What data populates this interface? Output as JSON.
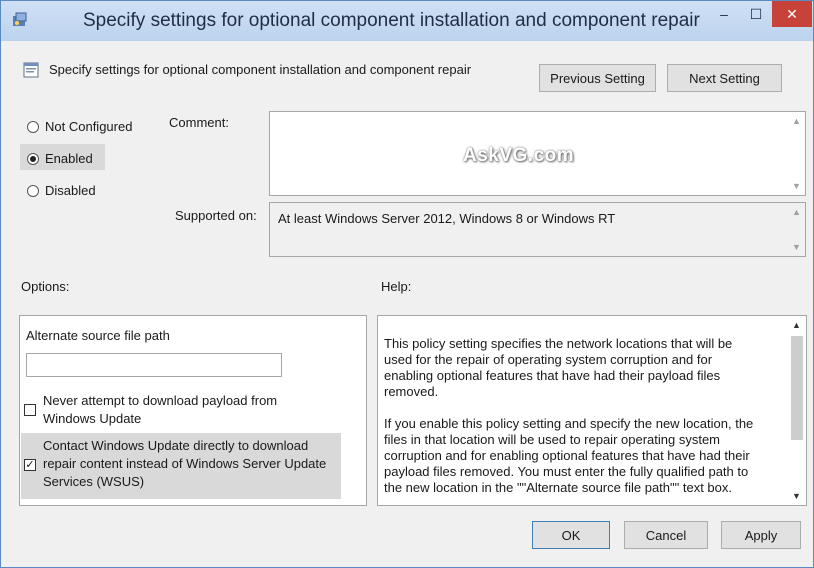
{
  "window": {
    "title": "Specify settings for optional component installation and component repair",
    "controls": {
      "minimize": "–",
      "maximize": "☐",
      "close": "✕"
    }
  },
  "header": {
    "setting_name": "Specify settings for optional component installation and component repair",
    "previous_label": "Previous Setting",
    "next_label": "Next Setting"
  },
  "state": {
    "options": [
      {
        "label": "Not Configured",
        "selected": false
      },
      {
        "label": "Enabled",
        "selected": true
      },
      {
        "label": "Disabled",
        "selected": false
      }
    ]
  },
  "comment": {
    "label": "Comment:",
    "value": ""
  },
  "watermark": "AskVG.com",
  "supported": {
    "label": "Supported on:",
    "value": "At least Windows Server 2012, Windows 8 or Windows RT"
  },
  "options_section": {
    "label": "Options:",
    "alt_path_label": "Alternate source file path",
    "alt_path_value": "",
    "never_download": {
      "label": "Never attempt to download payload from Windows Update",
      "checked": false
    },
    "contact_wu": {
      "label": "Contact Windows Update directly to download repair content instead of Windows Server Update Services (WSUS)",
      "checked": true
    }
  },
  "help": {
    "label": "Help:",
    "paragraphs": [
      "This policy setting specifies the network locations that will be used for the repair of operating system corruption and for enabling optional features that have had their payload files removed.",
      "If you enable this policy setting and specify the new location, the files in that location will be used to repair operating system corruption and for enabling optional features that have had their payload files removed. You must enter the fully qualified path to the new location in the \"\"Alternate source file path\"\" text box."
    ]
  },
  "footer": {
    "ok": "OK",
    "cancel": "Cancel",
    "apply": "Apply"
  },
  "colors": {
    "titlebar": "#c4d8f0",
    "close_button": "#c7433a",
    "dialog_bg": "#f0f0f0"
  }
}
